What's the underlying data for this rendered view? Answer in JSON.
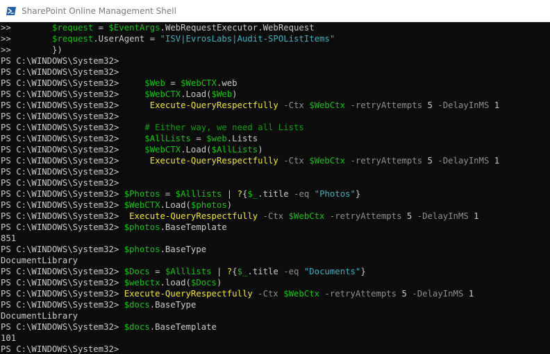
{
  "window": {
    "title": "SharePoint Online Management Shell",
    "icon": "powershell-icon",
    "colors": {
      "icon_bg": "#1f5fb0",
      "background": "#0c0c0c"
    }
  },
  "colors": {
    "default": "#cccccc",
    "variable": "#13c513",
    "command": "#f2e92a",
    "string": "#3cb1c1",
    "parameter": "#8f8f8f",
    "comment": "#0f9e0f"
  },
  "console": {
    "lines": [
      [
        [
          "default",
          ">>        "
        ],
        [
          "var",
          "$request"
        ],
        [
          "default",
          " = "
        ],
        [
          "var",
          "$EventArgs"
        ],
        [
          "default",
          ".WebRequestExecutor.WebRequest"
        ]
      ],
      [
        [
          "default",
          ">>        "
        ],
        [
          "var",
          "$request"
        ],
        [
          "default",
          ".UserAgent = "
        ],
        [
          "str",
          "\"ISV|EvrosLabs|Audit-SPOListItems\""
        ]
      ],
      [
        [
          "default",
          ">>        })"
        ]
      ],
      [
        [
          "default",
          "PS C:\\WINDOWS\\System32>"
        ]
      ],
      [
        [
          "default",
          "PS C:\\WINDOWS\\System32>"
        ]
      ],
      [
        [
          "default",
          "PS C:\\WINDOWS\\System32>     "
        ],
        [
          "var",
          "$Web"
        ],
        [
          "default",
          " = "
        ],
        [
          "var",
          "$WebCTX"
        ],
        [
          "default",
          ".web"
        ]
      ],
      [
        [
          "default",
          "PS C:\\WINDOWS\\System32>     "
        ],
        [
          "var",
          "$WebCTX"
        ],
        [
          "default",
          ".Load("
        ],
        [
          "var",
          "$Web"
        ],
        [
          "default",
          ")"
        ]
      ],
      [
        [
          "default",
          "PS C:\\WINDOWS\\System32>      "
        ],
        [
          "cmd",
          "Execute-QueryRespectfully"
        ],
        [
          "param",
          " -Ctx "
        ],
        [
          "var",
          "$WebCtx"
        ],
        [
          "param",
          " -retryAttempts "
        ],
        [
          "default",
          "5"
        ],
        [
          "param",
          " -DelayInMS "
        ],
        [
          "default",
          "1"
        ]
      ],
      [
        [
          "default",
          "PS C:\\WINDOWS\\System32>"
        ]
      ],
      [
        [
          "default",
          "PS C:\\WINDOWS\\System32>     "
        ],
        [
          "cmt",
          "# Either way, we need all Lists"
        ]
      ],
      [
        [
          "default",
          "PS C:\\WINDOWS\\System32>     "
        ],
        [
          "var",
          "$AllLists"
        ],
        [
          "default",
          " = "
        ],
        [
          "var",
          "$web"
        ],
        [
          "default",
          ".Lists"
        ]
      ],
      [
        [
          "default",
          "PS C:\\WINDOWS\\System32>     "
        ],
        [
          "var",
          "$WebCTX"
        ],
        [
          "default",
          ".Load("
        ],
        [
          "var",
          "$AllLists"
        ],
        [
          "default",
          ")"
        ]
      ],
      [
        [
          "default",
          "PS C:\\WINDOWS\\System32>      "
        ],
        [
          "cmd",
          "Execute-QueryRespectfully"
        ],
        [
          "param",
          " -Ctx "
        ],
        [
          "var",
          "$WebCtx"
        ],
        [
          "param",
          " -retryAttempts "
        ],
        [
          "default",
          "5"
        ],
        [
          "param",
          " -DelayInMS "
        ],
        [
          "default",
          "1"
        ]
      ],
      [
        [
          "default",
          "PS C:\\WINDOWS\\System32>"
        ]
      ],
      [
        [
          "default",
          "PS C:\\WINDOWS\\System32>"
        ]
      ],
      [
        [
          "default",
          "PS C:\\WINDOWS\\System32> "
        ],
        [
          "var",
          "$Photos"
        ],
        [
          "default",
          " = "
        ],
        [
          "var",
          "$Alllists"
        ],
        [
          "default",
          " | "
        ],
        [
          "cmd",
          "?"
        ],
        [
          "default",
          "{"
        ],
        [
          "var",
          "$_"
        ],
        [
          "default",
          ".title "
        ],
        [
          "param",
          "-eq"
        ],
        [
          "default",
          " "
        ],
        [
          "str",
          "\"Photos\""
        ],
        [
          "default",
          "}"
        ]
      ],
      [
        [
          "default",
          "PS C:\\WINDOWS\\System32> "
        ],
        [
          "var",
          "$WebCTX"
        ],
        [
          "default",
          ".Load("
        ],
        [
          "var",
          "$photos"
        ],
        [
          "default",
          ")"
        ]
      ],
      [
        [
          "default",
          "PS C:\\WINDOWS\\System32>  "
        ],
        [
          "cmd",
          "Execute-QueryRespectfully"
        ],
        [
          "param",
          " -Ctx "
        ],
        [
          "var",
          "$WebCtx"
        ],
        [
          "param",
          " -retryAttempts "
        ],
        [
          "default",
          "5"
        ],
        [
          "param",
          " -DelayInMS "
        ],
        [
          "default",
          "1"
        ]
      ],
      [
        [
          "default",
          "PS C:\\WINDOWS\\System32> "
        ],
        [
          "var",
          "$photos"
        ],
        [
          "default",
          ".BaseTemplate"
        ]
      ],
      [
        [
          "default",
          "851"
        ]
      ],
      [
        [
          "default",
          "PS C:\\WINDOWS\\System32> "
        ],
        [
          "var",
          "$photos"
        ],
        [
          "default",
          ".BaseType"
        ]
      ],
      [
        [
          "default",
          "DocumentLibrary"
        ]
      ],
      [
        [
          "default",
          "PS C:\\WINDOWS\\System32> "
        ],
        [
          "var",
          "$Docs"
        ],
        [
          "default",
          " = "
        ],
        [
          "var",
          "$Alllists"
        ],
        [
          "default",
          " | "
        ],
        [
          "cmd",
          "?"
        ],
        [
          "default",
          "{"
        ],
        [
          "var",
          "$_"
        ],
        [
          "default",
          ".title "
        ],
        [
          "param",
          "-eq"
        ],
        [
          "default",
          " "
        ],
        [
          "str",
          "\"Documents\""
        ],
        [
          "default",
          "}"
        ]
      ],
      [
        [
          "default",
          "PS C:\\WINDOWS\\System32> "
        ],
        [
          "var",
          "$webctx"
        ],
        [
          "default",
          ".load("
        ],
        [
          "var",
          "$Docs"
        ],
        [
          "default",
          ")"
        ]
      ],
      [
        [
          "default",
          "PS C:\\WINDOWS\\System32> "
        ],
        [
          "cmd",
          "Execute-QueryRespectfully"
        ],
        [
          "param",
          " -Ctx "
        ],
        [
          "var",
          "$WebCtx"
        ],
        [
          "param",
          " -retryAttempts "
        ],
        [
          "default",
          "5"
        ],
        [
          "param",
          " -DelayInMS "
        ],
        [
          "default",
          "1"
        ]
      ],
      [
        [
          "default",
          "PS C:\\WINDOWS\\System32> "
        ],
        [
          "var",
          "$docs"
        ],
        [
          "default",
          ".BaseType"
        ]
      ],
      [
        [
          "default",
          "DocumentLibrary"
        ]
      ],
      [
        [
          "default",
          "PS C:\\WINDOWS\\System32> "
        ],
        [
          "var",
          "$docs"
        ],
        [
          "default",
          ".BaseTemplate"
        ]
      ],
      [
        [
          "default",
          "101"
        ]
      ],
      [
        [
          "default",
          "PS C:\\WINDOWS\\System32>"
        ]
      ]
    ]
  }
}
